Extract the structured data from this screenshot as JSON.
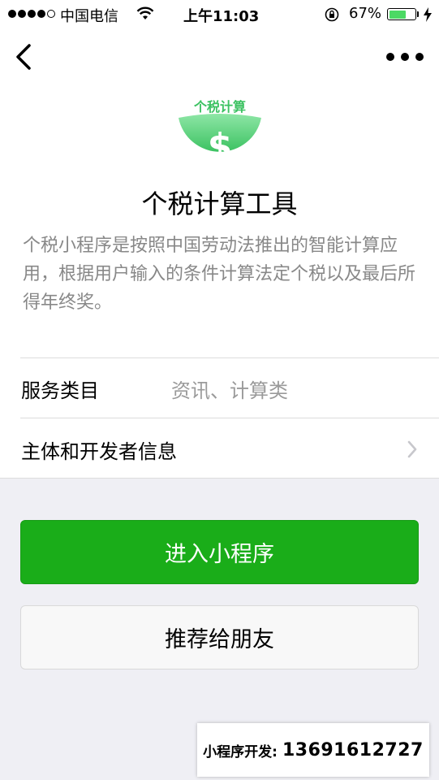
{
  "status_bar": {
    "carrier": "中国电信",
    "time": "上午11:03",
    "battery_percent": "67%",
    "battery_level": 0.67,
    "battery_color": "#4cd964"
  },
  "nav": {
    "back_icon": "chevron-left-icon",
    "more_icon": "more-dots-icon"
  },
  "app": {
    "logo_label": "个税计算",
    "logo_symbol": "$",
    "logo_colors": [
      "#8ee6a6",
      "#3cc262"
    ],
    "title": "个税计算工具",
    "description": "个税小程序是按照中国劳动法推出的智能计算应用，根据用户输入的条件计算法定个税以及最后所得年终奖。"
  },
  "info_rows": [
    {
      "label": "服务类目",
      "value": "资讯、计算类"
    },
    {
      "label": "主体和开发者信息"
    }
  ],
  "buttons": {
    "enter": "进入小程序",
    "recommend": "推荐给朋友"
  },
  "colors": {
    "primary": "#1aad19",
    "page_bg": "#efeff4"
  },
  "watermark": {
    "label": "小程序开发:",
    "phone": "13691612727"
  }
}
